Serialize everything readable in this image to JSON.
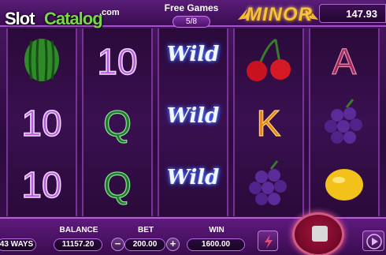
{
  "logo": {
    "part1": "Slot",
    "part2": "Catalog",
    "suffix": ".com"
  },
  "free_games": {
    "title": "Free Games",
    "count": "5/8"
  },
  "jackpot": {
    "label": "MINOR"
  },
  "credit": "147.93",
  "reels": [
    [
      "watermelon",
      "10",
      "10"
    ],
    [
      "10",
      "Q",
      "Q"
    ],
    [
      "wild",
      "wild",
      "wild"
    ],
    [
      "cherry",
      "K",
      "grapes"
    ],
    [
      "A",
      "grapes",
      "lemon"
    ]
  ],
  "wild_text": "Wild",
  "symbol_text": {
    "ten": "10",
    "q": "Q",
    "k": "K",
    "a": "A"
  },
  "bottom": {
    "ways": "43 WAYS",
    "balance_label": "BALANCE",
    "balance": "11157.20",
    "bet_label": "BET",
    "bet": "200.00",
    "minus": "−",
    "plus": "+",
    "win_label": "WIN",
    "win": "1600.00"
  },
  "icons": [
    "lightning-icon",
    "stop-icon",
    "play-icon"
  ]
}
